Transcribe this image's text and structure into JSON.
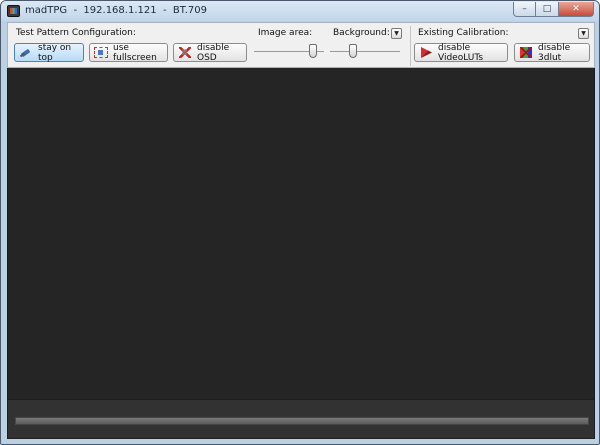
{
  "window": {
    "title": "madTPG  -  192.168.1.121  -  BT.709",
    "controls": {
      "minimize": "–",
      "maximize": "□",
      "close": "✕"
    }
  },
  "toolbar": {
    "test_pattern": {
      "label": "Test Pattern Configuration:",
      "buttons": {
        "stay_on_top": {
          "label": "stay on top",
          "active": true
        },
        "use_fullscreen": {
          "label": "use fullscreen"
        },
        "disable_osd": {
          "label": "disable OSD"
        }
      }
    },
    "image_area": {
      "label": "Image area:"
    },
    "background": {
      "label": "Background:"
    },
    "existing_calibration": {
      "label": "Existing Calibration:",
      "buttons": {
        "disable_videoluts": {
          "label": "disable VideoLUTs"
        },
        "disable_3dlut": {
          "label": "disable 3dlut"
        }
      }
    }
  },
  "progress": {
    "value": 0
  },
  "colors": {
    "viewport": "#252525",
    "footer": "#323232",
    "active_button": "#b7dbf6",
    "titlebar": "#c2d5ea"
  },
  "icons": {
    "app": "madtpg-app-icon",
    "stay_on_top": "pin-icon",
    "use_fullscreen": "fullscreen-icon",
    "disable_osd": "osd-disabled-icon",
    "disable_videoluts": "videolut-icon",
    "disable_3dlut": "3dlut-icon"
  }
}
